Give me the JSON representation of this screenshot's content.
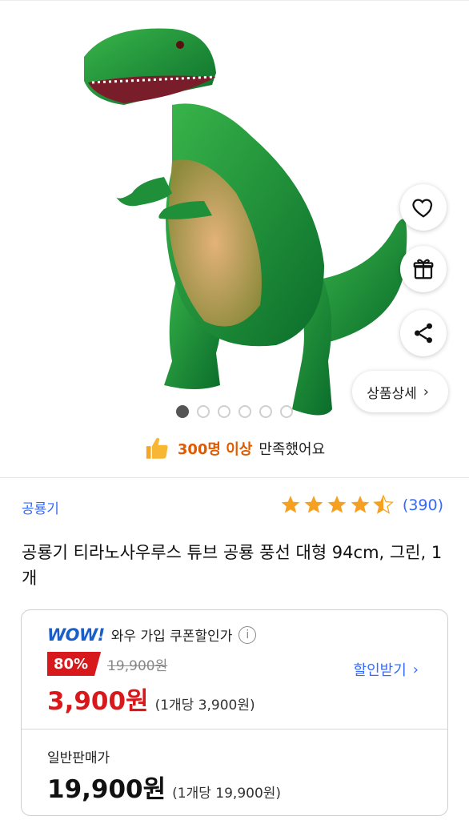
{
  "side_buttons": {
    "heart": "heart-icon",
    "gift": "gift-icon",
    "share": "share-icon"
  },
  "detail_button": {
    "label": "상품상세",
    "chevron": "›"
  },
  "carousel": {
    "total": 6,
    "active_index": 0
  },
  "satisfaction": {
    "highlight": "300명 이상",
    "text": "만족했어요"
  },
  "product": {
    "brand": "공룡기",
    "rating": 4.5,
    "review_count": "(390)",
    "title": "공룡기 티라노사우루스 튜브 공룡 풍선 대형 94cm, 그린, 1개"
  },
  "wow": {
    "logo": "WOW!",
    "label": "와우 가입 쿠폰할인가",
    "info_icon": "ⓘ",
    "discount": "80%",
    "original_price": "19,900원",
    "coupon_link": "할인받기",
    "coupon_chevron": "›",
    "sale_price": "3,900원",
    "unit_price": "(1개당 3,900원)"
  },
  "normal": {
    "label": "일반판매가",
    "price": "19,900원",
    "unit_price": "(1개당 19,900원)"
  },
  "colors": {
    "accent_blue": "#346aff",
    "sale_red": "#d8191c",
    "highlight_orange": "#e05a00"
  }
}
